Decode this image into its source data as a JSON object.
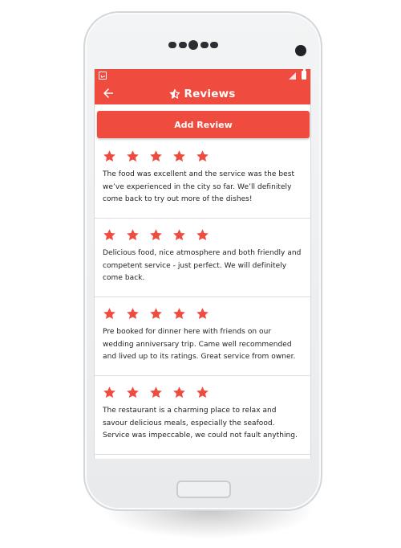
{
  "colors": {
    "accent": "#EF4B3F",
    "star": "#EF4B3F",
    "text": "#222222",
    "divider": "#DDDDDD"
  },
  "status_bar": {
    "left_icon": "image-icon",
    "signal_icon": "signal-icon",
    "battery_icon": "battery-icon"
  },
  "app_bar": {
    "back_icon": "arrow-left-icon",
    "title_icon": "star-half-icon",
    "title": "Reviews"
  },
  "add_review_button": {
    "label": "Add Review"
  },
  "reviews": [
    {
      "rating": 5,
      "text": "The food was excellent and the service was the best we’ve experienced in the city so far. We’ll definitely come back to try out more of the dishes!"
    },
    {
      "rating": 5,
      "text": "Delicious food, nice atmosphere and both friendly and competent service - just perfect. We will definitely come back."
    },
    {
      "rating": 5,
      "text": "Pre booked for dinner here with friends on our wedding anniversary trip. Came well recommended and lived up to its ratings. Great service from owner."
    },
    {
      "rating": 5,
      "text": "The restaurant is a charming place to relax and savour delicious meals, especially the seafood. Service was impeccable, we could not fault anything."
    }
  ]
}
